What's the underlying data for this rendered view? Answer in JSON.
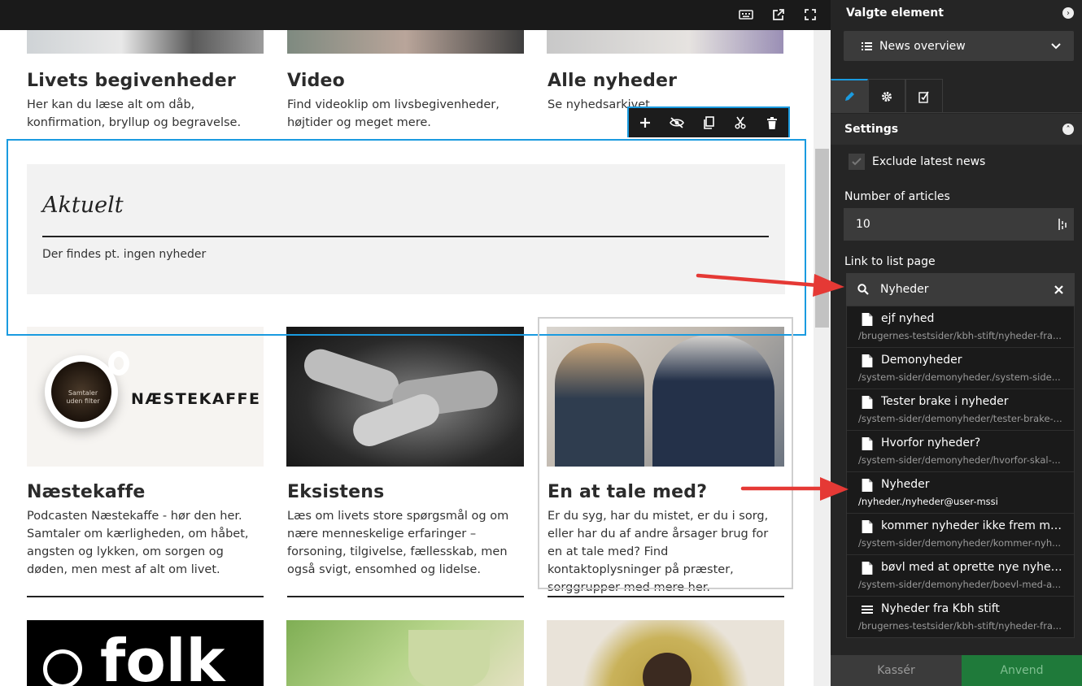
{
  "canvas": {
    "top_cards": [
      {
        "title": "Livets begivenheder",
        "text": "Her kan du læse alt om dåb, konfirmation, bryllup og begravelse."
      },
      {
        "title": "Video",
        "text": "Find videoklip om livsbegivenheder, højtider og meget mere."
      },
      {
        "title": "Alle nyheder",
        "text": "Se nyhedsarkivet"
      }
    ],
    "news_block": {
      "heading": "Aktuelt",
      "empty_text": "Der findes pt. ingen nyheder"
    },
    "cards": [
      {
        "title": "Næstekaffe",
        "text": "Podcasten Næstekaffe - hør den her. Samtaler om kærligheden, om håbet, angsten og lykken, om sorgen og døden, men mest af alt om livet.",
        "image_label": "NÆSTEKAFFE",
        "cup_label": "Samtaler uden filter"
      },
      {
        "title": "Eksistens",
        "text": "Læs om livets store spørgsmål og om nære menneskelige erfaringer – forsoning, tilgivelse, fællesskab, men også svigt, ensomhed og lidelse."
      },
      {
        "title": "En at tale med?",
        "text": "Er du syg, har du mistet, er du i sorg, eller har du af andre årsager brug for en at tale med? Find kontaktoplysninger på præster, sorggrupper med mere her."
      }
    ],
    "bottom_image_text": "folk"
  },
  "panel": {
    "title": "Valgte element",
    "element_type": "News overview",
    "section": "Settings",
    "exclude_label": "Exclude latest news",
    "articles_label": "Number of articles",
    "articles_value": "10",
    "link_label": "Link to list page",
    "search_value": "Nyheder",
    "results": [
      {
        "title": "ejf nyhed",
        "path": "/brugernes-testsider/kbh-stift/nyheder-fra...",
        "icon": "page-icon"
      },
      {
        "title": "Demonyheder",
        "path": "/system-sider/demonyheder./system-side...",
        "icon": "page-icon"
      },
      {
        "title": "Tester brake i nyheder",
        "path": "/system-sider/demonyheder/tester-brake-...",
        "icon": "page-icon"
      },
      {
        "title": "Hvorfor nyheder?",
        "path": "/system-sider/demonyheder/hvorfor-skal-...",
        "icon": "page-icon"
      },
      {
        "title": "Nyheder",
        "path": "/nyheder./nyheder@user-mssi",
        "icon": "page-icon"
      },
      {
        "title": "kommer nyheder ikke frem mer...",
        "path": "/system-sider/demonyheder/kommer-nyh...",
        "icon": "page-icon"
      },
      {
        "title": "bøvl med at oprette nye nyheder",
        "path": "/system-sider/demonyheder/boevl-med-a...",
        "icon": "page-icon"
      },
      {
        "title": "Nyheder fra Kbh stift",
        "path": "/brugernes-testsider/kbh-stift/nyheder-fra...",
        "icon": "list-icon"
      }
    ],
    "cancel_label": "Kassér",
    "apply_label": "Anvend"
  },
  "colors": {
    "accent": "#1a9be0",
    "arrow": "#e53935",
    "apply": "#1f7a3a",
    "panel_bg": "#252525"
  }
}
